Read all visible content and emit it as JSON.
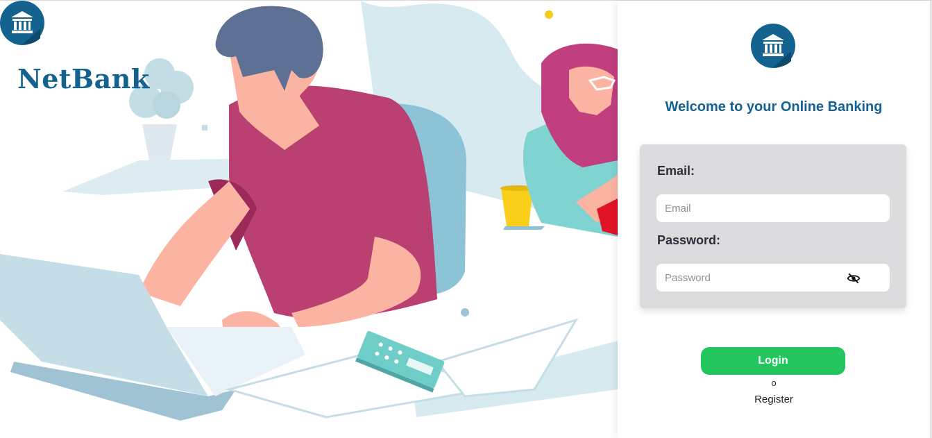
{
  "brand": {
    "name": "NetBank",
    "logo_icon": "bank-icon",
    "color": "#14628f"
  },
  "login": {
    "welcome": "Welcome to your Online Banking",
    "email_label": "Email:",
    "email_placeholder": "Email",
    "email_value": "",
    "password_label": "Password:",
    "password_placeholder": "Password",
    "password_value": "",
    "password_toggle_icon": "eye-off-icon",
    "login_label": "Login",
    "separator": "o",
    "register_label": "Register"
  },
  "colors": {
    "accent": "#14628f",
    "login_button": "#22c55e",
    "card_bg": "#dcdcde"
  }
}
